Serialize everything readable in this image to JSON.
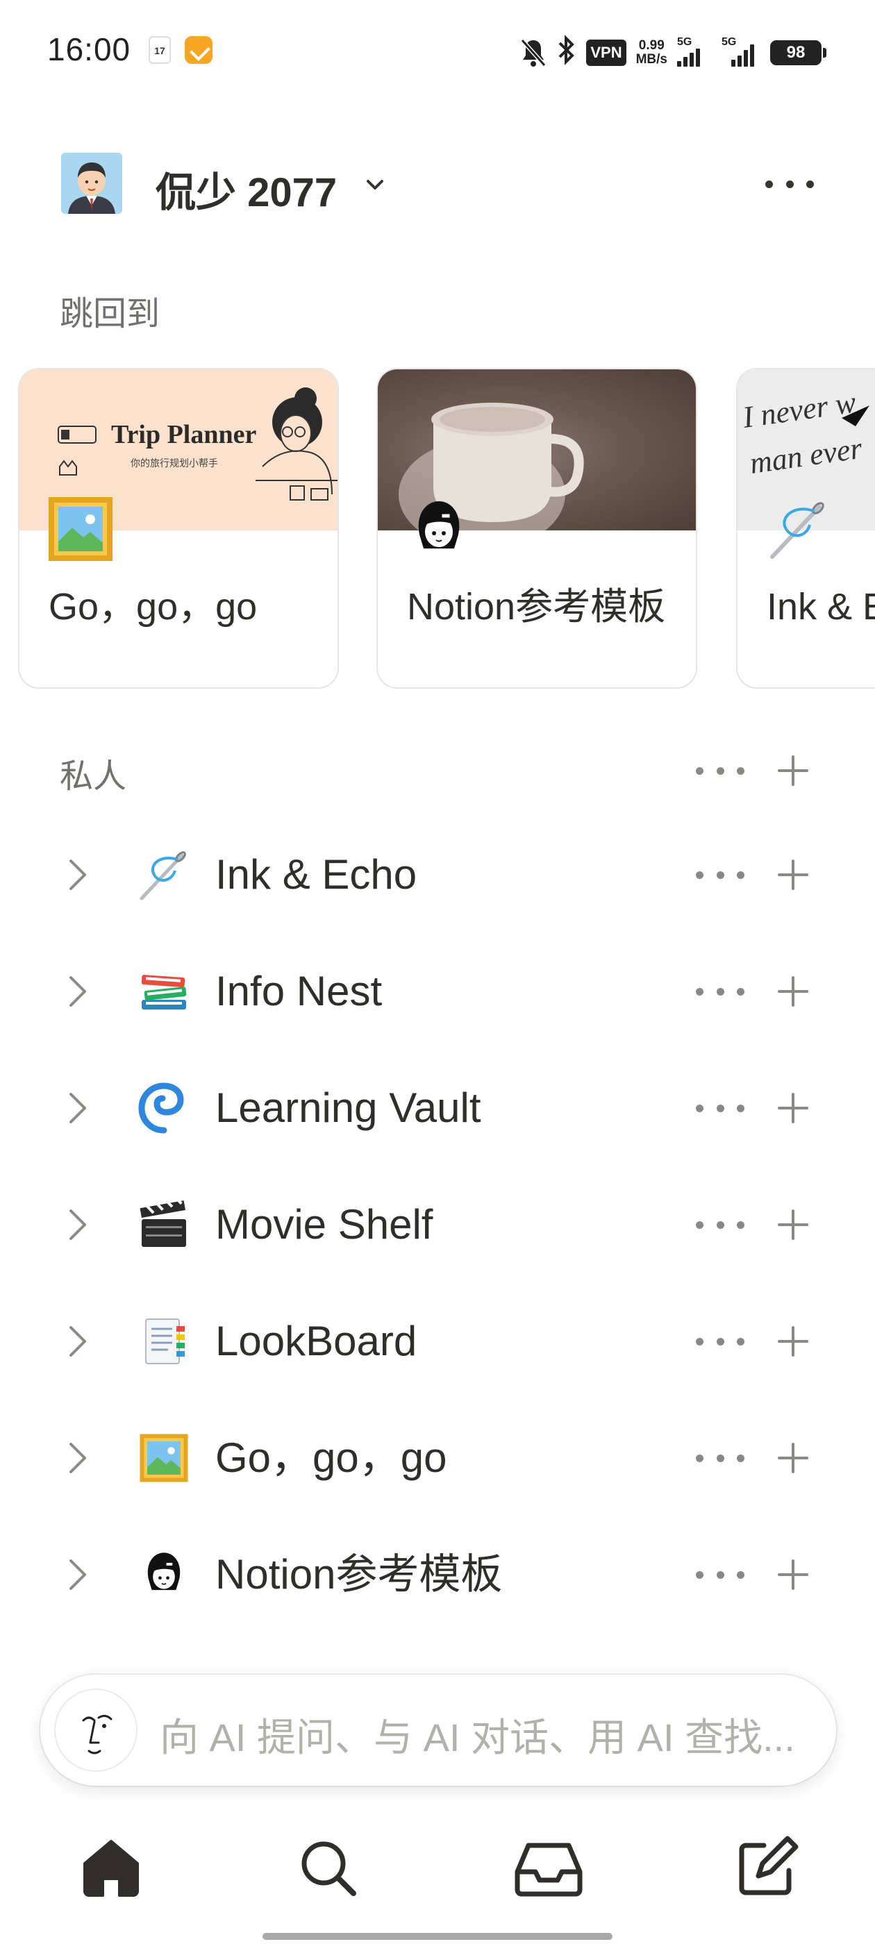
{
  "status_bar": {
    "time": "16:00",
    "calendar_day": "17",
    "vpn": "VPN",
    "speed_value": "0.99",
    "speed_unit": "MB/s",
    "signal_1": "5G",
    "signal_2": "5G",
    "battery": "98"
  },
  "workspace": {
    "name": "侃少 2077"
  },
  "jump_back": {
    "title": "跳回到",
    "cards": [
      {
        "title": "Go，go，go",
        "cover_title": "Trip Planner",
        "cover_subtitle": "你的旅行规划小帮手",
        "icon": "framed-picture-icon"
      },
      {
        "title": "Notion参考模板",
        "icon": "girl-avatar-icon"
      },
      {
        "title": "Ink & E",
        "cover_text_1": "I never w",
        "cover_text_2": "man ever",
        "icon": "needle-icon"
      }
    ]
  },
  "private": {
    "title": "私人",
    "items": [
      {
        "label": "Ink & Echo",
        "icon": "needle-icon"
      },
      {
        "label": "Info Nest",
        "icon": "books-icon"
      },
      {
        "label": "Learning Vault",
        "icon": "cyclone-icon"
      },
      {
        "label": "Movie Shelf",
        "icon": "clapper-icon"
      },
      {
        "label": "LookBoard",
        "icon": "bookmark-tabs-icon"
      },
      {
        "label": "Go，go，go",
        "icon": "framed-picture-icon"
      },
      {
        "label": "Notion参考模板",
        "icon": "girl-avatar-icon"
      }
    ]
  },
  "ai_bar": {
    "placeholder": "向 AI 提问、与 AI 对话、用 AI 查找..."
  },
  "bottom_nav": [
    "home-icon",
    "search-icon",
    "inbox-icon",
    "compose-icon"
  ]
}
